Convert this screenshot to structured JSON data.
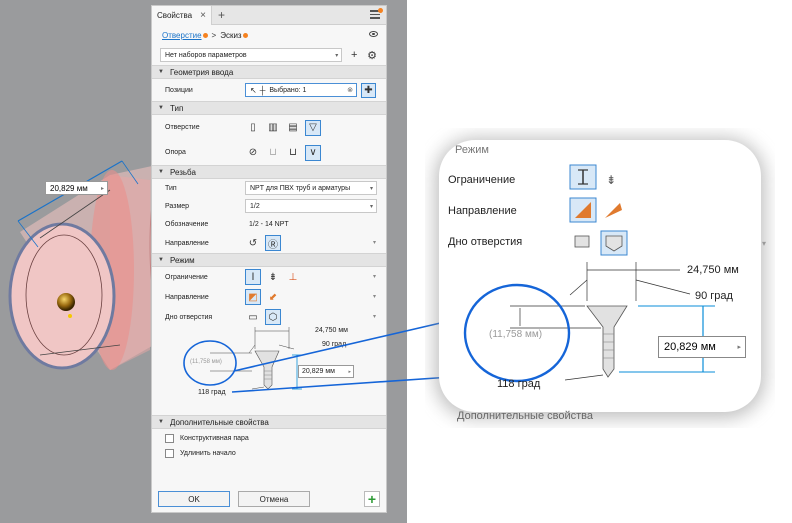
{
  "viewport": {
    "dimension_value": "20,829 мм"
  },
  "panel": {
    "tab_title": "Свойства",
    "breadcrumb": {
      "link": "Отверстие",
      "separator": ">",
      "current": "Эскиз"
    },
    "preset": "Нет наборов параметров",
    "sections": {
      "input_geometry": "Геометрия ввода",
      "type": "Тип",
      "thread": "Резьба",
      "mode": "Режим",
      "extra": "Дополнительные свойства"
    },
    "positions": {
      "label": "Позиции",
      "value": "Выбрано: 1"
    },
    "type_rows": {
      "hole": "Отверстие",
      "support": "Опора"
    },
    "thread_rows": {
      "type_label": "Тип",
      "type_value": "NPT для ПВХ труб и арматуры",
      "size_label": "Размер",
      "size_value": "1/2",
      "designation_label": "Обозначение",
      "designation_value": "1/2 - 14 NPT",
      "direction_label": "Направление"
    },
    "mode_rows": {
      "termination": "Ограничение",
      "direction": "Направление",
      "bottom": "Дно отверстия"
    },
    "hole_dims": {
      "diameter": "24,750 мм",
      "angle": "90 град",
      "depth": "20,829 мм",
      "thread_len": "(11,758 мм)",
      "tip_angle": "118 град"
    },
    "extra": {
      "construction": "Конструктивная пара",
      "extend_start": "Удлинить начало"
    },
    "buttons": {
      "ok": "OK",
      "cancel": "Отмена"
    }
  },
  "zoom": {
    "section_title": "Режим",
    "termination": "Ограничение",
    "direction": "Направление",
    "bottom": "Дно отверстия",
    "diameter": "24,750 мм",
    "angle": "90 град",
    "thread_len": "(11,758 мм)",
    "depth": "20,829 мм",
    "tip_angle": "118 град",
    "extra": "Дополнительные свойства"
  },
  "colors": {
    "accent": "#1a73c9",
    "callout": "#1565d8",
    "dimension_blue": "#0a8ed8",
    "orange": "#f58220"
  }
}
